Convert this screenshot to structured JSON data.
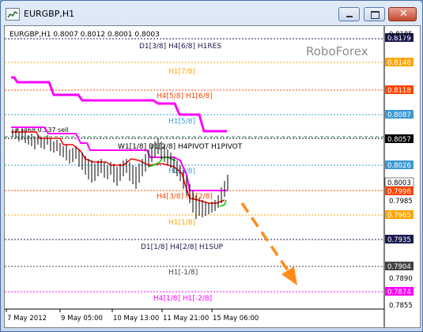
{
  "window": {
    "title": "EURGBP,H1"
  },
  "chart": {
    "symbol_info": "EURGBP,H1  0.8007 0.8012 0.8001 0.8003",
    "watermark": "RoboForex",
    "bid_label": "#3468 0.537 sell",
    "price_ticks": [
      "0.8185",
      "0.7985",
      "0.7890",
      "0.7855"
    ],
    "price_tags": [
      {
        "text": "0.8179",
        "bg": "#1a1a50",
        "fg": "#ffffff"
      },
      {
        "text": "0.8148",
        "bg": "#ffa500",
        "fg": "#ffffff"
      },
      {
        "text": "0.8118",
        "bg": "#ff4500",
        "fg": "#ffffff"
      },
      {
        "text": "0.8087",
        "bg": "#3c9ad6",
        "fg": "#ffffff"
      },
      {
        "text": "0.8057",
        "bg": "#000000",
        "fg": "#ffffff"
      },
      {
        "text": "0.8026",
        "bg": "#3c9ad6",
        "fg": "#ffffff"
      },
      {
        "text": "0.8003",
        "bg": "#ffffff",
        "fg": "#000000"
      },
      {
        "text": "0.7996",
        "bg": "#ff4500",
        "fg": "#ffffff"
      },
      {
        "text": "0.7965",
        "bg": "#ffa500",
        "fg": "#ffffff"
      },
      {
        "text": "0.7935",
        "bg": "#1a1a50",
        "fg": "#ffffff"
      },
      {
        "text": "0.7904",
        "bg": "#444444",
        "fg": "#ffffff"
      },
      {
        "text": "0.7874",
        "bg": "#ff00ff",
        "fg": "#ffffff"
      }
    ],
    "level_labels": [
      {
        "text": "D1[3/8] H4[6/8] H1RES",
        "color": "#1a1a50"
      },
      {
        "text": "H1[7/8]",
        "color": "#ffa500"
      },
      {
        "text": "H4[5/8] H1[6/8]",
        "color": "#ff4500"
      },
      {
        "text": "H1[5/8]",
        "color": "#3c9ad6"
      },
      {
        "text": "W1[1/8] D1[2/8] H4PIVOT H1PIVOT",
        "color": "#000000"
      },
      {
        "text": "H1[3/8]",
        "color": "#3c9ad6"
      },
      {
        "text": "H4[3/8] H1[2/8]",
        "color": "#ff4500"
      },
      {
        "text": "H1[1/8]",
        "color": "#ffa500"
      },
      {
        "text": "D1[1/8] H4[2/8] H1SUP",
        "color": "#1a1a50"
      },
      {
        "text": "H1[-1/8]",
        "color": "#444444"
      },
      {
        "text": "H4[1/8] H1[-2/8]",
        "color": "#ff00ff"
      }
    ],
    "time_labels": [
      "7 May 2012",
      "9 May 05:00",
      "10 May 13:00",
      "11 May 21:00",
      "15 May 06:00"
    ],
    "colors": {
      "magenta_line": "#ff00ff",
      "red_line": "#ff0000",
      "green_line": "#00cc00",
      "forecast_arrow": "#ff8c1a",
      "bars": "#000000"
    }
  }
}
